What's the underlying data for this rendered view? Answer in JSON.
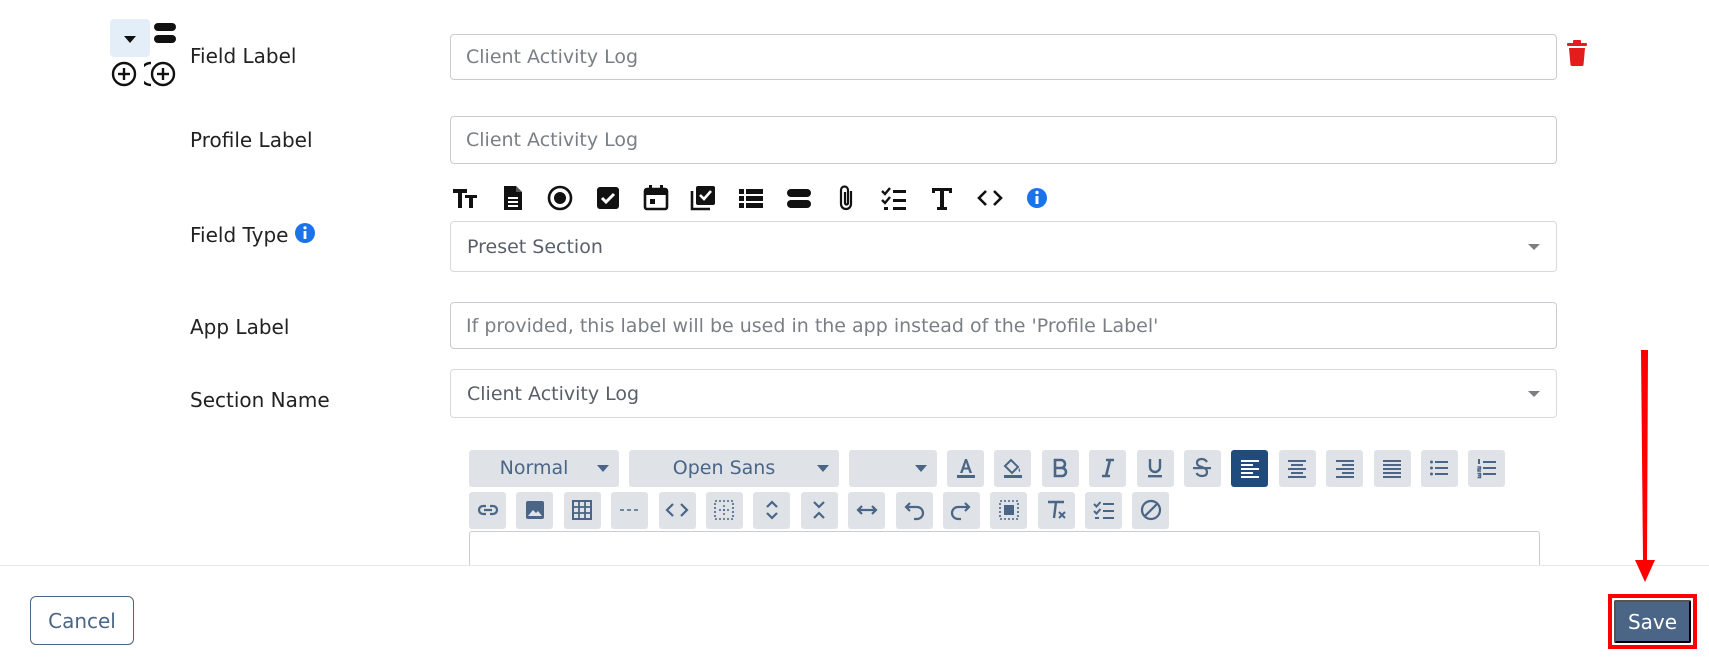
{
  "fields": {
    "field_label": {
      "label": "Field Label",
      "value": "Client Activity Log"
    },
    "profile_label": {
      "label": "Profile Label",
      "value": "Client Activity Log"
    },
    "field_type": {
      "label": "Field Type",
      "selected": "Preset Section"
    },
    "app_label": {
      "label": "App Label",
      "placeholder": "If provided, this label will be used in the app instead of the 'Profile Label'"
    },
    "section_name": {
      "label": "Section Name",
      "selected": "Client Activity Log"
    }
  },
  "field_type_icons": [
    "text-size-icon",
    "document-icon",
    "radio-icon",
    "checkbox-icon",
    "calendar-icon",
    "multi-checkbox-icon",
    "list-icon",
    "section-icon",
    "attachment-icon",
    "checklist-icon",
    "text-icon",
    "code-icon",
    "info-icon"
  ],
  "editor": {
    "format_select": "Normal",
    "font_select": "Open Sans",
    "size_select": ""
  },
  "footer": {
    "cancel_label": "Cancel",
    "save_label": "Save"
  },
  "colors": {
    "primary": "#4a6585",
    "active_toolbar": "#1f4b7d",
    "delete": "#e31c1c",
    "info": "#1a73e8",
    "highlight": "#ff0000"
  }
}
